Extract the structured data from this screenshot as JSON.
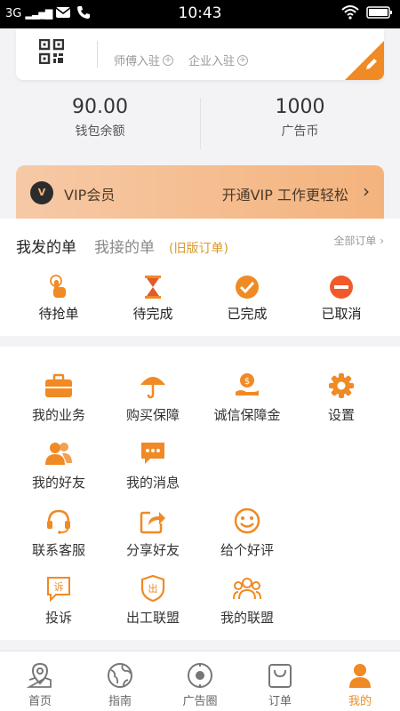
{
  "status_bar": {
    "signal": "3G",
    "time": "10:43"
  },
  "top_card": {
    "master_join": "师傅入驻",
    "company_join": "企业入驻"
  },
  "stats": [
    {
      "value": "90.00",
      "label": "钱包余额"
    },
    {
      "value": "1000",
      "label": "广告币"
    }
  ],
  "vip": {
    "badge": "V",
    "title": "VIP会员",
    "action": "开通VIP  工作更轻松"
  },
  "orders": {
    "tab_posted": "我发的单",
    "tab_received": "我接的单",
    "tab_old": "(旧版订单)",
    "all_orders": "全部订单",
    "statuses": [
      "待抢单",
      "待完成",
      "已完成",
      "已取消"
    ]
  },
  "services": [
    {
      "label": "我的业务",
      "icon": "briefcase-icon"
    },
    {
      "label": "购买保障",
      "icon": "umbrella-icon"
    },
    {
      "label": "诚信保障金",
      "icon": "coin-hand-icon"
    },
    {
      "label": "设置",
      "icon": "gear-icon"
    },
    {
      "label": "我的好友",
      "icon": "friends-icon"
    },
    {
      "label": "我的消息",
      "icon": "message-icon"
    },
    {
      "label": "联系客服",
      "icon": "headset-icon"
    },
    {
      "label": "分享好友",
      "icon": "share-icon"
    },
    {
      "label": "给个好评",
      "icon": "smile-icon"
    },
    {
      "label": "投诉",
      "icon": "complain-icon"
    },
    {
      "label": "出工联盟",
      "icon": "shield-icon"
    },
    {
      "label": "我的联盟",
      "icon": "group-icon"
    }
  ],
  "services_complain_glyph": "诉",
  "services_shield_glyph": "出",
  "bottom_nav": [
    {
      "label": "首页",
      "icon": "map-pin-icon"
    },
    {
      "label": "指南",
      "icon": "globe-icon"
    },
    {
      "label": "广告圈",
      "icon": "target-icon"
    },
    {
      "label": "订单",
      "icon": "bag-icon"
    },
    {
      "label": "我的",
      "icon": "person-icon"
    }
  ],
  "colors": {
    "accent": "#f08a24",
    "vip_bg": "#f4b37d",
    "text": "#333333"
  }
}
